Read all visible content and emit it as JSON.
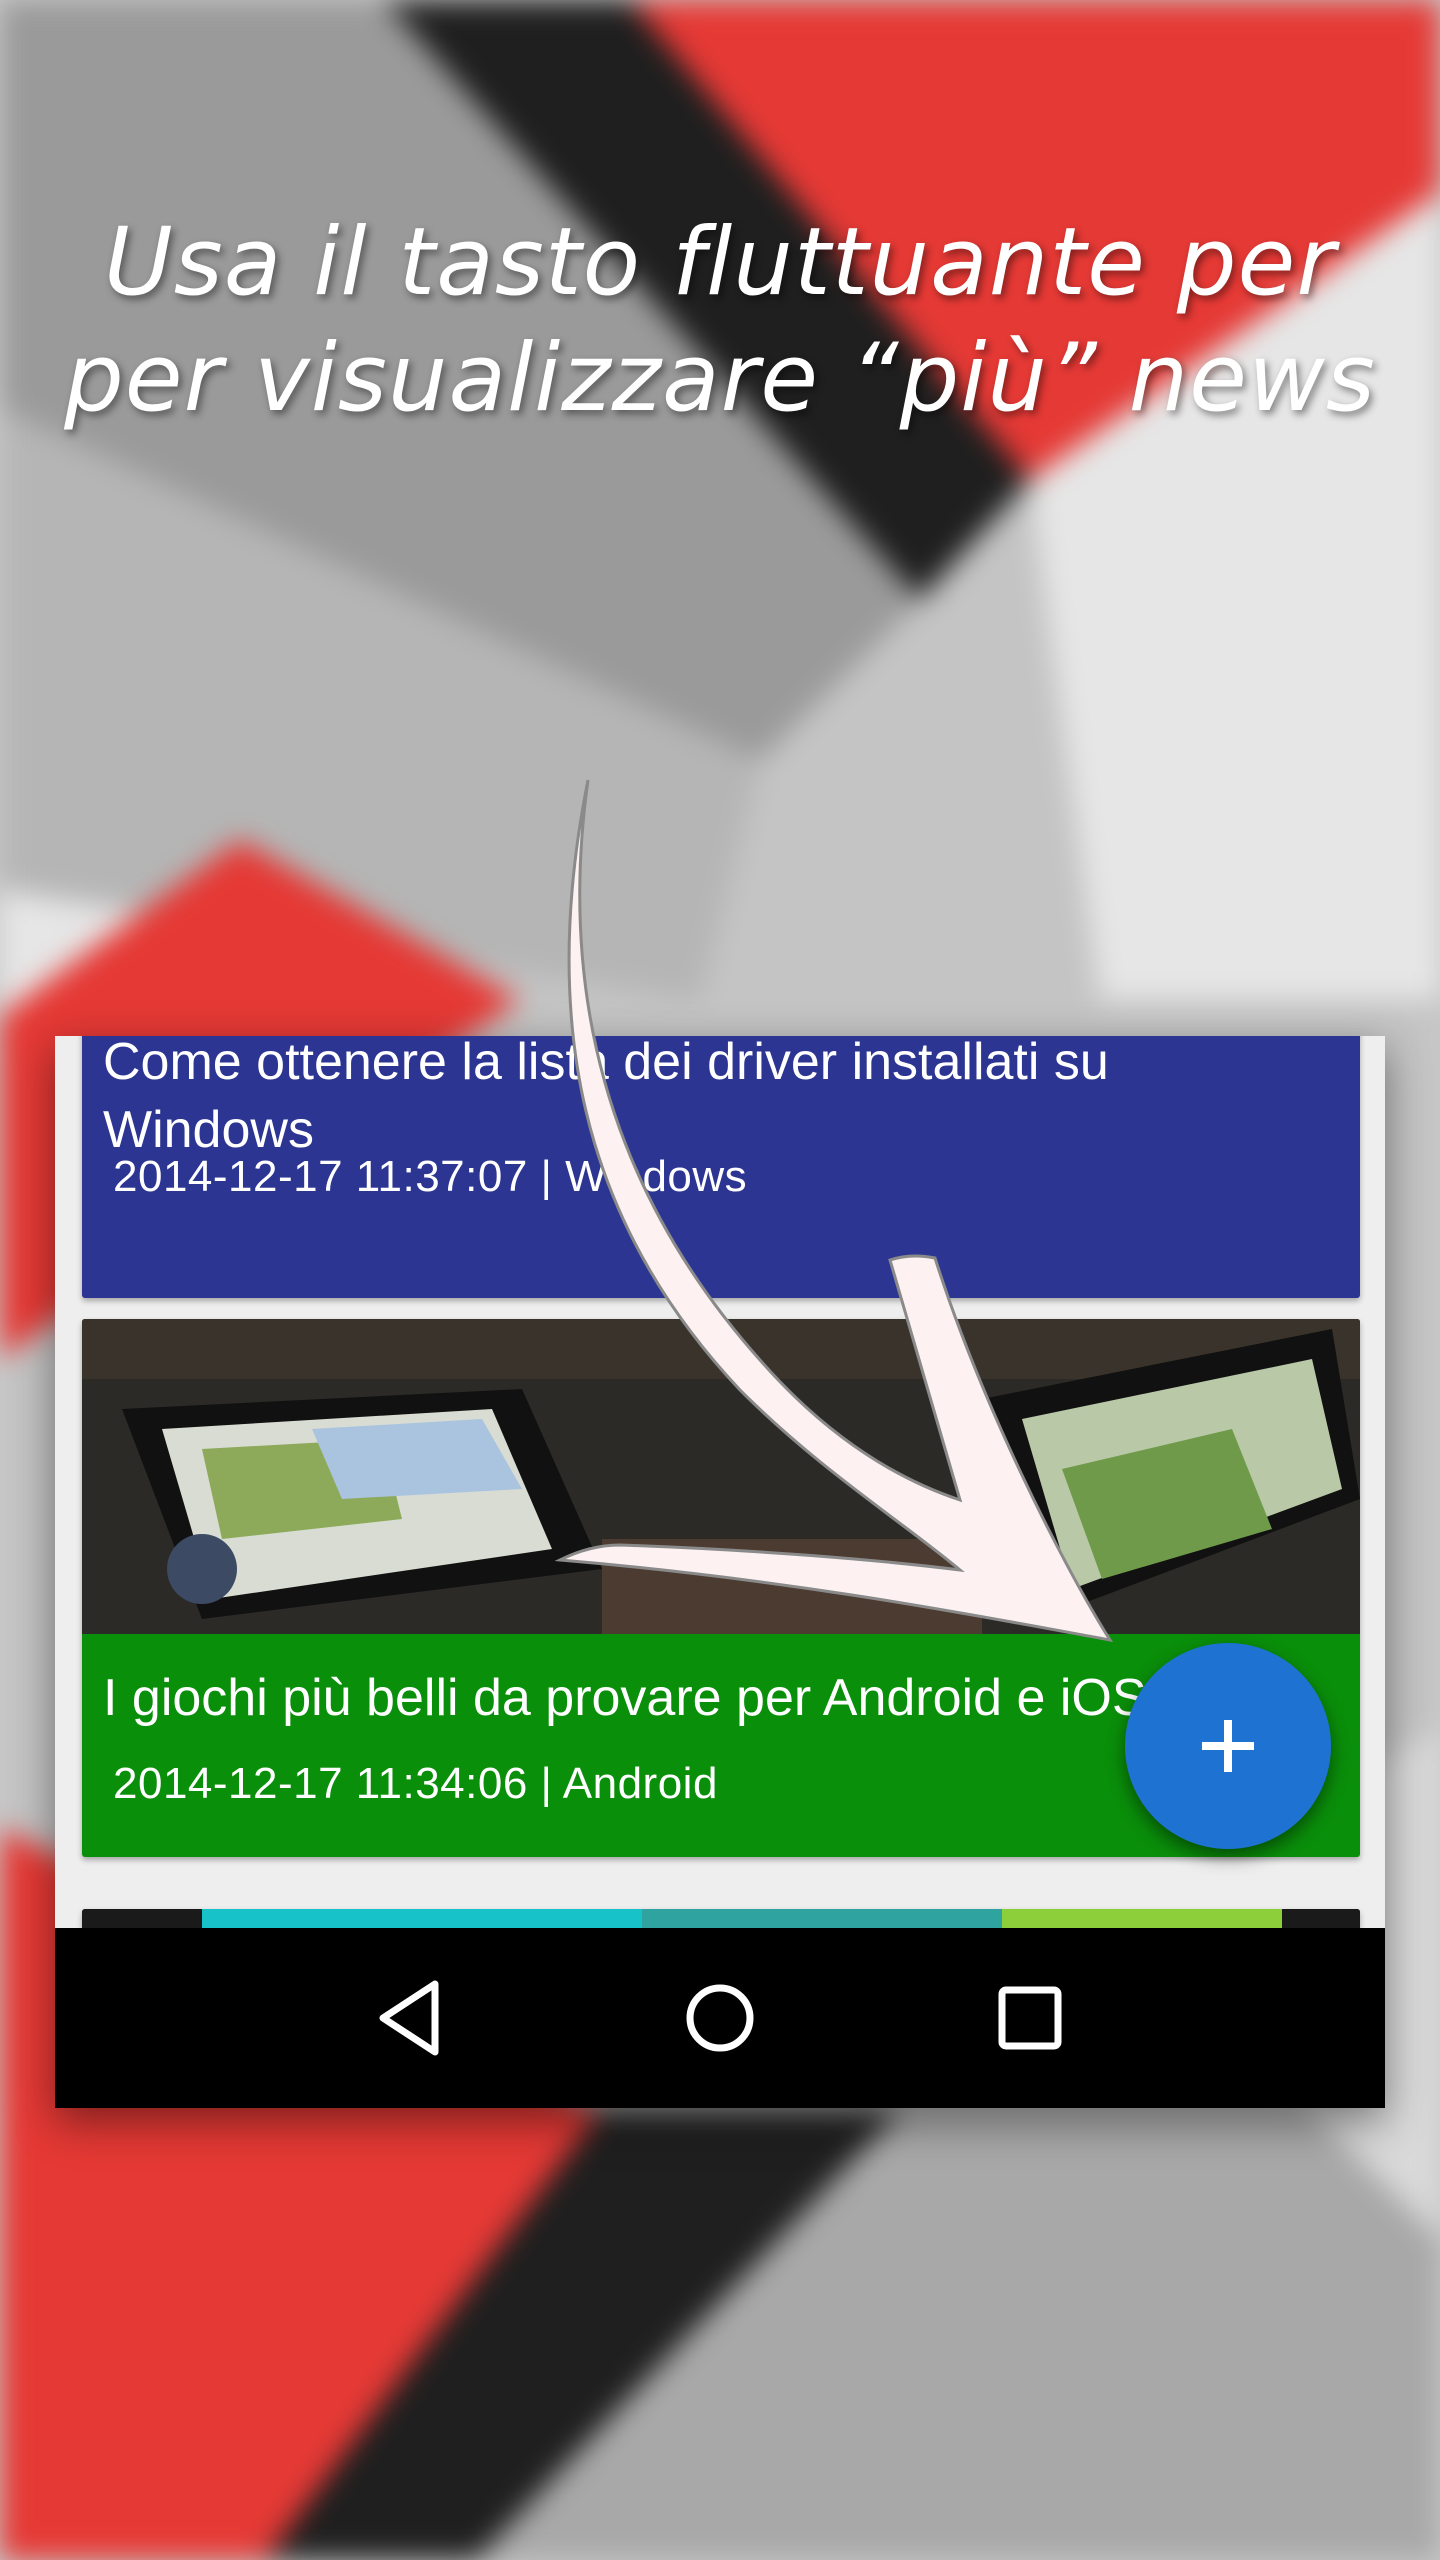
{
  "headline": {
    "line1": "Usa il tasto fluttuante per",
    "line2": "per visualizzare “più” news"
  },
  "feed": {
    "items": [
      {
        "title": "Come ottenere la lista dei driver installati su Windows",
        "meta": "2014-12-17 11:37:07 | Windows",
        "color": "#2c3591"
      },
      {
        "title": "I giochi più belli da provare per Android e iOS",
        "meta": "2014-12-17 11:34:06 | Android",
        "color": "#0a8f0a"
      }
    ]
  },
  "fab": {
    "icon": "plus-icon",
    "color": "#1e73d2"
  },
  "navbar": {
    "icons": [
      "back-icon",
      "home-icon",
      "recents-icon"
    ]
  },
  "colors": {
    "red": "#e53935",
    "dark": "#1e1e1e",
    "gray": "#a6a6a6",
    "light": "#e3e3e3"
  }
}
